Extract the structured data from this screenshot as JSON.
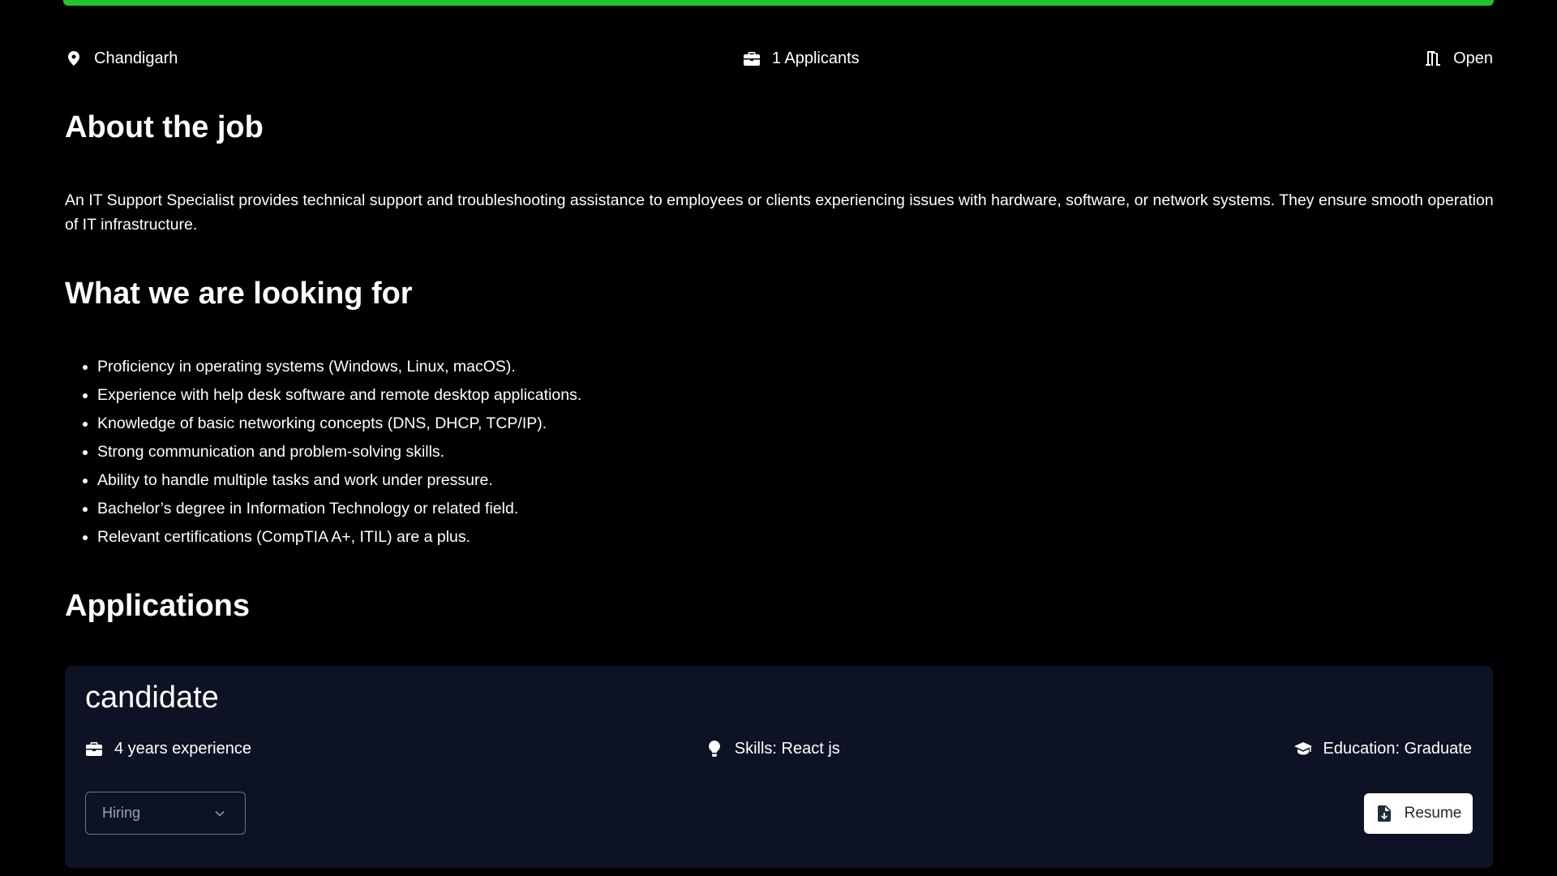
{
  "job": {
    "location": "Chandigarh",
    "applicants": "1 Applicants",
    "status": "Open"
  },
  "about": {
    "heading": "About the job",
    "text": "An IT Support Specialist provides technical support and troubleshooting assistance to employees or clients experiencing issues with hardware, software, or network systems. They ensure smooth operation of IT infrastructure."
  },
  "looking_for": {
    "heading": "What we are looking for",
    "items": [
      "Proficiency in operating systems (Windows, Linux, macOS).",
      "Experience with help desk software and remote desktop applications.",
      "Knowledge of basic networking concepts (DNS, DHCP, TCP/IP).",
      "Strong communication and problem-solving skills.",
      "Ability to handle multiple tasks and work under pressure.",
      "Bachelor’s degree in Information Technology or related field.",
      "Relevant certifications (CompTIA A+, ITIL) are a plus."
    ]
  },
  "applications": {
    "heading": "Applications",
    "card": {
      "name": "candidate",
      "experience": "4 years experience",
      "skills": "Skills: React js",
      "education": "Education: Graduate",
      "status_value": "Hiring",
      "resume_label": "Resume"
    }
  },
  "colors": {
    "accent_bar": "#22c52a",
    "background": "#000000",
    "card_background": "#0d1324"
  },
  "icons": {
    "location": "map-pin-icon",
    "applicants": "briefcase-icon",
    "status": "door-open-icon",
    "experience": "briefcase-icon",
    "skills": "lightbulb-icon",
    "education": "graduation-cap-icon",
    "dropdown": "chevron-down-icon",
    "resume": "file-download-icon"
  }
}
